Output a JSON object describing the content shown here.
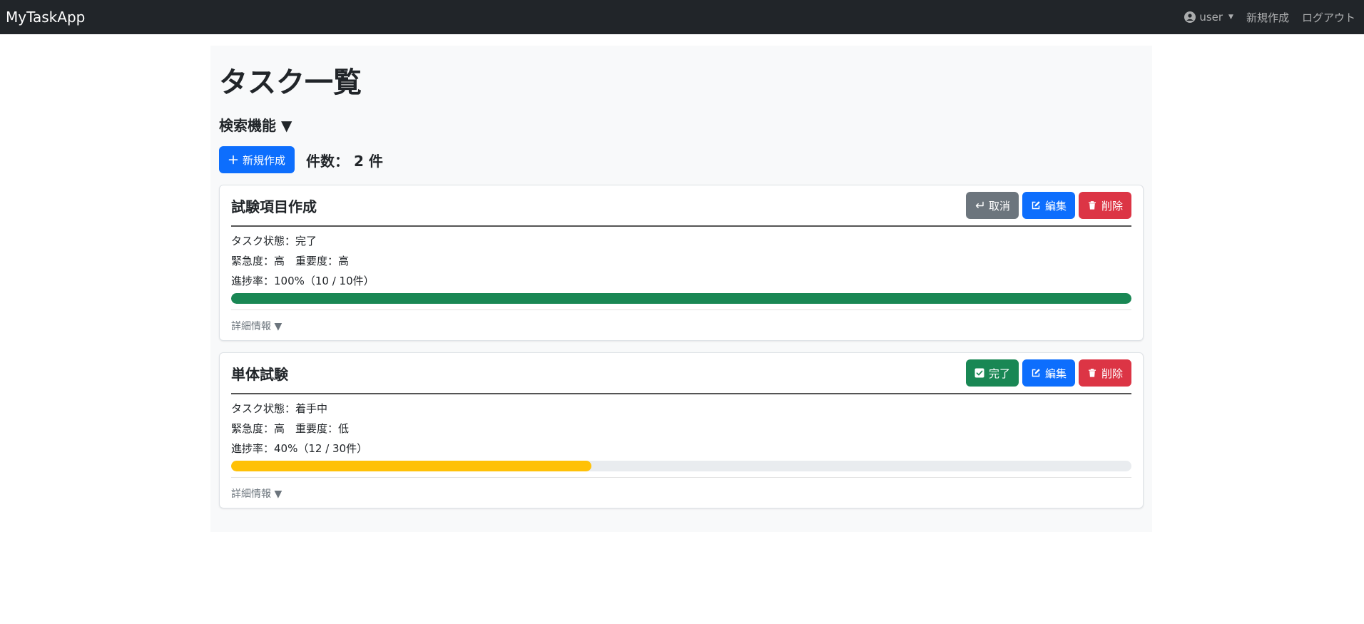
{
  "navbar": {
    "brand": "MyTaskApp",
    "user": "user",
    "new_link": "新規作成",
    "logout_link": "ログアウト"
  },
  "page": {
    "title": "タスク一覧",
    "search_toggle": "検索機能 ▼",
    "new_button": "新規作成",
    "count_label": "件数： 2 件"
  },
  "tasks": [
    {
      "title": "試験項目作成",
      "toggle_label": "取消",
      "toggle_icon": "return-icon",
      "edit_label": "編集",
      "delete_label": "削除",
      "status": "タスク状態：完了",
      "priority": "緊急度：高　重要度：高",
      "progress_text": "進捗率：100%（10 / 10件）",
      "progress_percent": 100,
      "progress_color": "#198754",
      "detail": "詳細情報 ▼"
    },
    {
      "title": "単体試験",
      "toggle_label": "完了",
      "toggle_icon": "check-square-icon",
      "edit_label": "編集",
      "delete_label": "削除",
      "status": "タスク状態：着手中",
      "priority": "緊急度：高　重要度：低",
      "progress_text": "進捗率：40%（12 / 30件）",
      "progress_percent": 40,
      "progress_color": "#ffc107",
      "detail": "詳細情報 ▼"
    }
  ],
  "colors": {
    "navbar_bg": "#212529",
    "primary": "#0d6efd",
    "success": "#198754",
    "secondary": "#6c757d",
    "danger": "#dc3545",
    "warning": "#ffc107"
  }
}
